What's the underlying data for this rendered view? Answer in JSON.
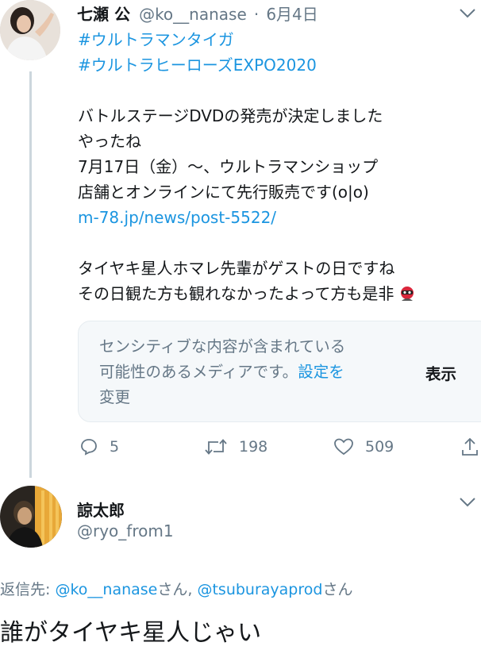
{
  "tweet": {
    "author_name": "七瀬 公",
    "author_handle": "@ko__nanase",
    "separator": "·",
    "date": "6月4日",
    "lines": [
      {
        "text": "#ウルトラマンタイガ",
        "kind": "link"
      },
      {
        "text": "#ウルトラヒーローズEXPO2020",
        "kind": "link"
      },
      {
        "text": "",
        "kind": "blank"
      },
      {
        "text": "バトルステージDVDの発売が決定しました",
        "kind": "text"
      },
      {
        "text": "やったね",
        "kind": "text"
      },
      {
        "text": "7月17日（金）〜、ウルトラマンショップ",
        "kind": "text"
      },
      {
        "text": "店舗とオンラインにて先行販売です(o|o)",
        "kind": "text"
      },
      {
        "text": "m-78.jp/news/post-5522/",
        "kind": "link"
      },
      {
        "text": "",
        "kind": "blank"
      },
      {
        "text": "タイヤキ星人ホマレ先輩がゲストの日ですね",
        "kind": "text"
      },
      {
        "text": "その日観た方も観れなかったよって方も是非",
        "kind": "text"
      }
    ],
    "sensitive": {
      "line1": "センシティブな内容が含まれている",
      "line2_prefix": "可能性のあるメディアです。",
      "settings_link_part1": "設定を",
      "settings_link_part2": "変更",
      "show_label": "表示"
    },
    "actions": {
      "replies": "5",
      "retweets": "198",
      "likes": "509"
    }
  },
  "reply": {
    "author_name": "諒太郎",
    "author_handle": "@ryo_from1",
    "replying_to_label": "返信先:",
    "mention1": "@ko__nanase",
    "san1": "さん,",
    "mention2": "@tsuburayaprod",
    "san2": "さん",
    "body": "誰がタイヤキ星人じゃい"
  },
  "colors": {
    "accent": "#1b95e0",
    "muted": "#657786",
    "line": "#ccd6dd"
  }
}
